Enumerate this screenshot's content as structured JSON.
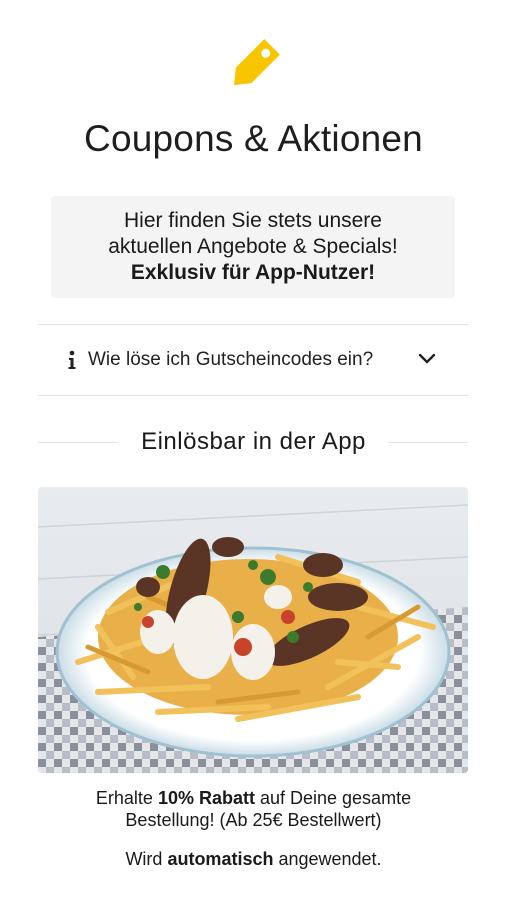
{
  "header": {
    "icon": "price-tag-icon",
    "title": "Coupons & Aktionen"
  },
  "promo": {
    "line1": "Hier finden Sie stets unsere",
    "line2": "aktuellen Angebote & Specials!",
    "line3": "Exklusiv für App-Nutzer!"
  },
  "faq": {
    "icon": "info-icon",
    "label": "Wie löse ich Gutscheincodes ein?",
    "toggle_icon": "chevron-down-icon"
  },
  "section": {
    "heading": "Einlösbar in der App"
  },
  "coupon": {
    "image": "plate of fries topped with grilled meat, herbs and sauce",
    "desc_prefix": "Erhalte ",
    "desc_bold": "10% Rabatt",
    "desc_suffix": " auf Deine gesamte",
    "desc_line2": "Bestellung! (Ab 25€ Bestellwert)",
    "auto_prefix": "Wird ",
    "auto_bold": "automatisch",
    "auto_suffix": " angewendet."
  },
  "colors": {
    "accent": "#F7C600",
    "panel": "#F4F4F4",
    "divider": "#E3E3E3"
  }
}
